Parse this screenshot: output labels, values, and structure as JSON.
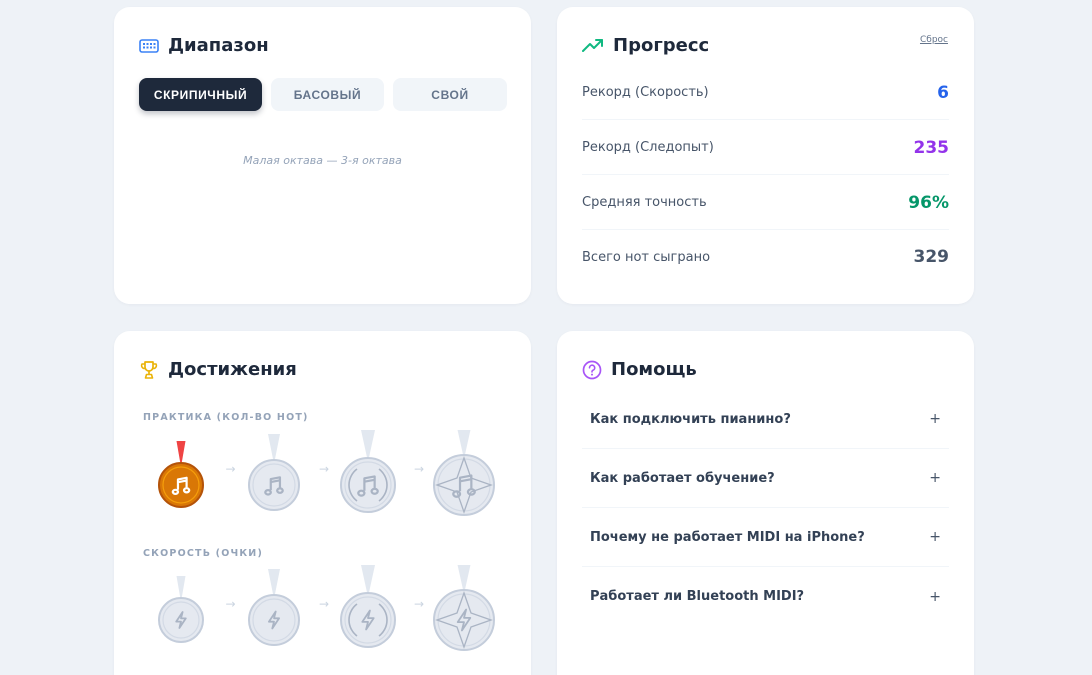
{
  "range": {
    "title": "Диапазон",
    "clefs": [
      "СКРИПИЧНЫЙ",
      "БАСОВЫЙ",
      "СВОЙ"
    ],
    "active_clef": "СКРИПИЧНЫЙ",
    "caption": "Малая октава — 3-я октава"
  },
  "progress": {
    "title": "Прогресс",
    "reset": "Сброс",
    "stats": [
      {
        "label": "Рекорд (Скорость)",
        "value": "6",
        "color": "#2563eb"
      },
      {
        "label": "Рекорд (Следопыт)",
        "value": "235",
        "color": "#9333ea"
      },
      {
        "label": "Средняя точность",
        "value": "96%",
        "color": "#059669"
      },
      {
        "label": "Всего нот сыграно",
        "value": "329",
        "color": "#475569"
      }
    ]
  },
  "achievements": {
    "title": "Достижения",
    "groups": [
      {
        "label": "ПРАКТИКА (КОЛ-ВО НОТ)",
        "icon": "music-note-icon",
        "unlocked": 1
      },
      {
        "label": "СКОРОСТЬ (ОЧКИ)",
        "icon": "lightning-icon",
        "unlocked": 0
      }
    ]
  },
  "help": {
    "title": "Помощь",
    "questions": [
      "Как подключить пианино?",
      "Как работает обучение?",
      "Почему не работает MIDI на iPhone?",
      "Работает ли Bluetooth MIDI?"
    ],
    "expand_symbol": "+"
  },
  "colors": {
    "accent_dark": "#1e293b",
    "medal_gold": "#d97706",
    "ribbon_red": "#ef4444",
    "locked_gray": "#cbd5e1"
  }
}
